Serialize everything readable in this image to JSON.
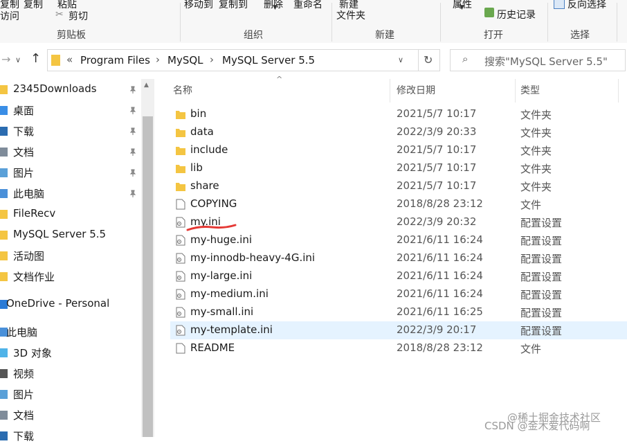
{
  "ribbon": {
    "top_labels": {
      "access": "访问",
      "copy": "复制",
      "paste": "粘贴",
      "cut": "剪切",
      "move_to": "移动到",
      "copy_to": "复制到",
      "delete": "删除",
      "rename": "重命名",
      "new": "新建",
      "folder": "文件夹",
      "properties": "属性",
      "history": "历史记录",
      "invert_select": "反向选择"
    },
    "groups": {
      "clipboard": "剪贴板",
      "organize": "组织",
      "new": "新建",
      "open": "打开",
      "select": "选择"
    }
  },
  "address": {
    "chevron": "«",
    "crumbs": [
      "Program Files",
      "MySQL",
      "MySQL Server 5.5"
    ],
    "search_placeholder": "搜索\"MySQL Server 5.5\""
  },
  "nav": {
    "items": [
      {
        "label": "2345Downloads",
        "icon": "folder-icon",
        "pinned": true
      },
      {
        "label": "桌面",
        "icon": "desktop-icon",
        "pinned": true
      },
      {
        "label": "下载",
        "icon": "download-icon",
        "pinned": true
      },
      {
        "label": "文档",
        "icon": "documents-icon",
        "pinned": true
      },
      {
        "label": "图片",
        "icon": "pictures-icon",
        "pinned": true
      },
      {
        "label": "此电脑",
        "icon": "computer-icon",
        "pinned": true
      },
      {
        "label": "FileRecv",
        "icon": "folder-icon",
        "pinned": false
      },
      {
        "label": "MySQL Server 5.5",
        "icon": "folder-icon",
        "pinned": false
      },
      {
        "label": "活动图",
        "icon": "folder-icon",
        "pinned": false
      },
      {
        "label": "文档作业",
        "icon": "folder-icon",
        "pinned": false
      },
      {
        "label": "OneDrive - Personal",
        "icon": "cloud-icon",
        "pinned": false
      },
      {
        "label": "此电脑",
        "icon": "computer-icon",
        "pinned": false
      },
      {
        "label": "3D 对象",
        "icon": "cube-icon",
        "pinned": false
      },
      {
        "label": "视频",
        "icon": "video-icon",
        "pinned": false
      },
      {
        "label": "图片",
        "icon": "pictures-icon",
        "pinned": false
      },
      {
        "label": "文档",
        "icon": "documents-icon",
        "pinned": false
      },
      {
        "label": "下载",
        "icon": "download-icon",
        "pinned": false
      }
    ]
  },
  "columns": {
    "name": "名称",
    "date": "修改日期",
    "type": "类型"
  },
  "files": [
    {
      "name": "bin",
      "date": "2021/5/7 10:17",
      "type": "文件夹",
      "icon": "folder-icon"
    },
    {
      "name": "data",
      "date": "2022/3/9 20:33",
      "type": "文件夹",
      "icon": "folder-icon"
    },
    {
      "name": "include",
      "date": "2021/5/7 10:17",
      "type": "文件夹",
      "icon": "folder-icon"
    },
    {
      "name": "lib",
      "date": "2021/5/7 10:17",
      "type": "文件夹",
      "icon": "folder-icon"
    },
    {
      "name": "share",
      "date": "2021/5/7 10:17",
      "type": "文件夹",
      "icon": "folder-icon"
    },
    {
      "name": "COPYING",
      "date": "2018/8/28 23:12",
      "type": "文件",
      "icon": "file-icon"
    },
    {
      "name": "my.ini",
      "date": "2022/3/9 20:32",
      "type": "配置设置",
      "icon": "ini-file-icon"
    },
    {
      "name": "my-huge.ini",
      "date": "2021/6/11 16:24",
      "type": "配置设置",
      "icon": "ini-file-icon"
    },
    {
      "name": "my-innodb-heavy-4G.ini",
      "date": "2021/6/11 16:24",
      "type": "配置设置",
      "icon": "ini-file-icon"
    },
    {
      "name": "my-large.ini",
      "date": "2021/6/11 16:24",
      "type": "配置设置",
      "icon": "ini-file-icon"
    },
    {
      "name": "my-medium.ini",
      "date": "2021/6/11 16:24",
      "type": "配置设置",
      "icon": "ini-file-icon"
    },
    {
      "name": "my-small.ini",
      "date": "2021/6/11 16:25",
      "type": "配置设置",
      "icon": "ini-file-icon"
    },
    {
      "name": "my-template.ini",
      "date": "2022/3/9 20:17",
      "type": "配置设置",
      "icon": "ini-file-icon",
      "selected": true
    },
    {
      "name": "README",
      "date": "2018/8/28 23:12",
      "type": "文件",
      "icon": "file-icon"
    }
  ],
  "watermarks": [
    "@稀土掘金技术社区",
    "CSDN @金木爱代码啊"
  ],
  "colors": {
    "folder": "#f4c542",
    "selected_row": "#e5f3ff",
    "annotation": "#e53935"
  }
}
